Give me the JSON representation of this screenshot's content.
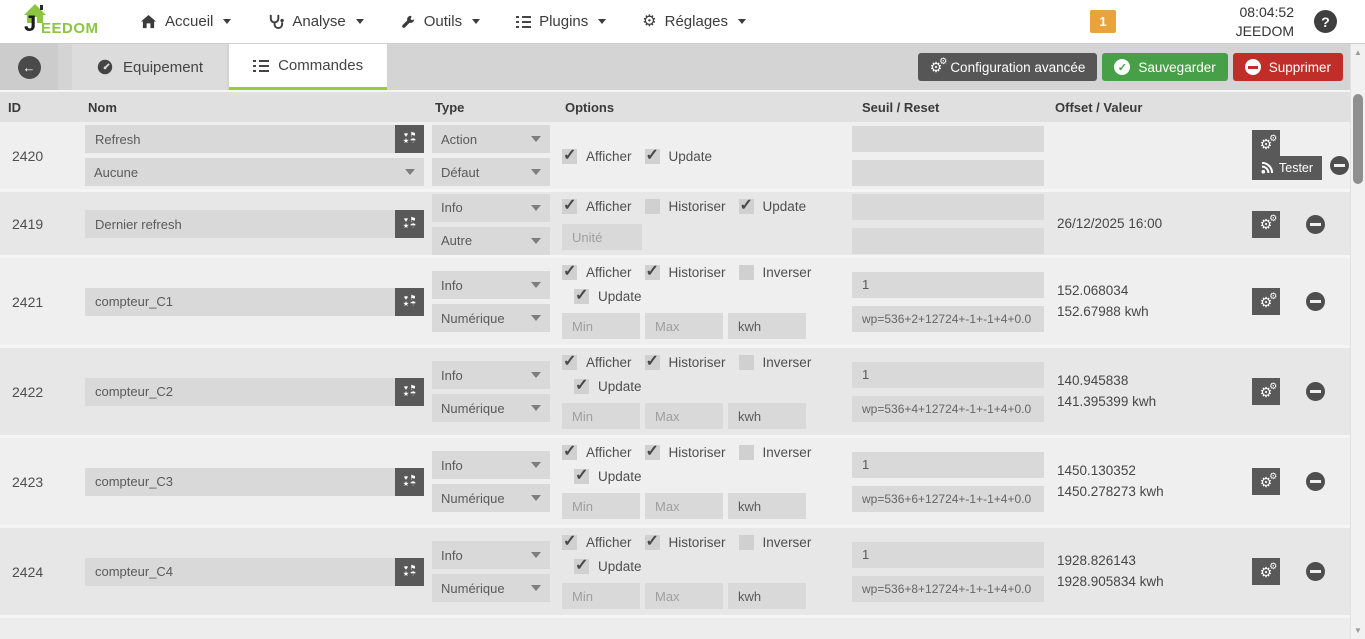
{
  "navbar": {
    "logo_j": "J",
    "logo_text": "EEDOM",
    "menus": [
      {
        "label": "Accueil",
        "icon": "home-icon"
      },
      {
        "label": "Analyse",
        "icon": "stethoscope-icon"
      },
      {
        "label": "Outils",
        "icon": "wrench-icon"
      },
      {
        "label": "Plugins",
        "icon": "list-icon"
      },
      {
        "label": "Réglages",
        "icon": "gear-icon"
      }
    ],
    "notification_badge": "1",
    "clock": "08:04:52",
    "username": "JEEDOM"
  },
  "toolbar": {
    "tabs": [
      {
        "label": "Equipement"
      },
      {
        "label": "Commandes"
      }
    ],
    "advanced_config_label": "Configuration avancée",
    "save_label": "Sauvegarder",
    "delete_label": "Supprimer",
    "tester_label": "Tester"
  },
  "table": {
    "headers": {
      "id": "ID",
      "name": "Nom",
      "type": "Type",
      "options": "Options",
      "threshold": "Seuil / Reset",
      "offset": "Offset / Valeur"
    },
    "option_labels": {
      "afficher": "Afficher",
      "historiser": "Historiser",
      "inverser": "Inverser",
      "update": "Update"
    },
    "placeholders": {
      "min": "Min",
      "max": "Max",
      "unit": "Unité"
    },
    "rows": [
      {
        "id": "2420",
        "name": "Refresh",
        "action_select": "Aucune",
        "type": "Action",
        "subtype": "Défaut",
        "afficher": true,
        "update": true,
        "seuil": "",
        "reset": ""
      },
      {
        "id": "2419",
        "name": "Dernier refresh",
        "type": "Info",
        "subtype": "Autre",
        "afficher": true,
        "historiser": false,
        "update": true,
        "seuil": "",
        "reset": "",
        "value_line1": "26/12/2025 16:00"
      },
      {
        "id": "2421",
        "name": "compteur_C1",
        "type": "Info",
        "subtype": "Numérique",
        "afficher": true,
        "historiser": true,
        "inverser": false,
        "update": true,
        "unit": "kwh",
        "seuil": "1",
        "reset": "wp=536+2+12724+-1+-1+4+0.0",
        "value_line1": "152.068034",
        "value_line2": "152.67988 kwh"
      },
      {
        "id": "2422",
        "name": "compteur_C2",
        "type": "Info",
        "subtype": "Numérique",
        "afficher": true,
        "historiser": true,
        "inverser": false,
        "update": true,
        "unit": "kwh",
        "seuil": "1",
        "reset": "wp=536+4+12724+-1+-1+4+0.0",
        "value_line1": "140.945838",
        "value_line2": "141.395399 kwh"
      },
      {
        "id": "2423",
        "name": "compteur_C3",
        "type": "Info",
        "subtype": "Numérique",
        "afficher": true,
        "historiser": true,
        "inverser": false,
        "update": true,
        "unit": "kwh",
        "seuil": "1",
        "reset": "wp=536+6+12724+-1+-1+4+0.0",
        "value_line1": "1450.130352",
        "value_line2": "1450.278273 kwh"
      },
      {
        "id": "2424",
        "name": "compteur_C4",
        "type": "Info",
        "subtype": "Numérique",
        "afficher": true,
        "historiser": true,
        "inverser": false,
        "update": true,
        "unit": "kwh",
        "seuil": "1",
        "reset": "wp=536+8+12724+-1+-1+4+0.0",
        "value_line1": "1928.826143",
        "value_line2": "1928.905834 kwh"
      }
    ]
  },
  "colors": {
    "accent_green": "#9ccc33",
    "save_green": "#47a047",
    "delete_red": "#bf2e29",
    "dark_button": "#565656",
    "badge_orange": "#e8a33d"
  }
}
